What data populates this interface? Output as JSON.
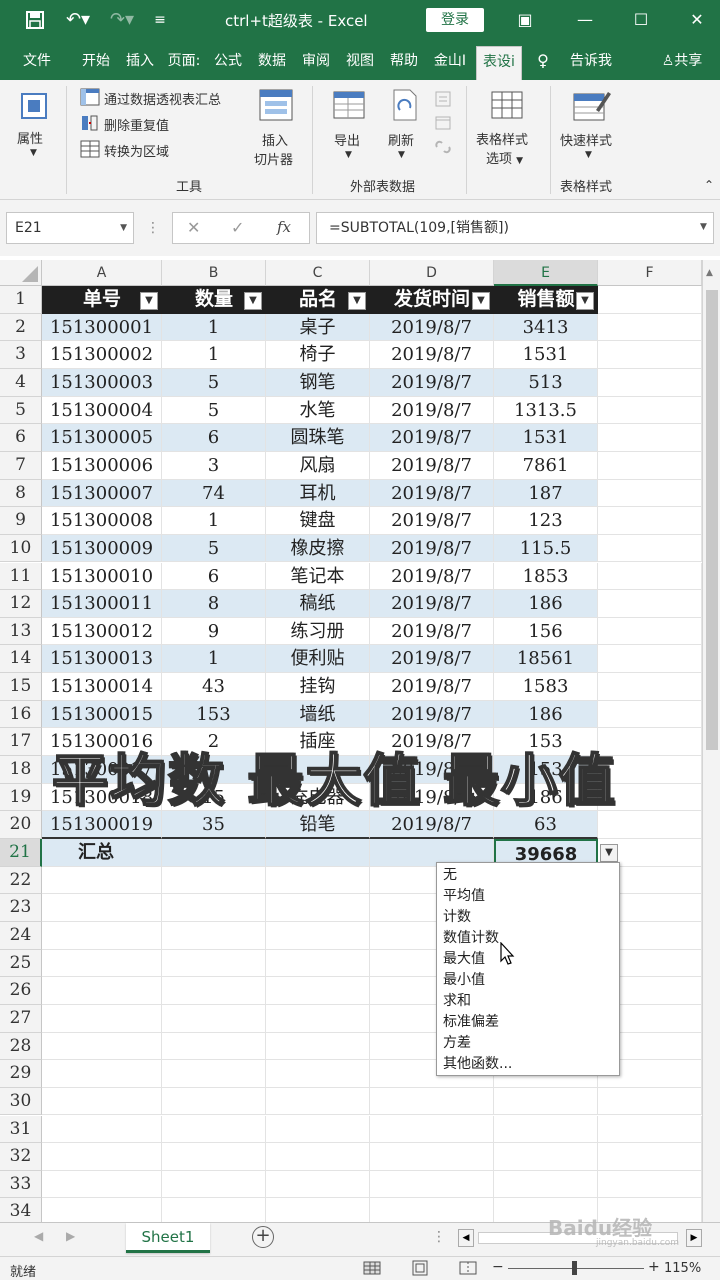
{
  "titlebar": {
    "save_icon": "save-icon",
    "undo_icon": "undo-icon",
    "redo_icon": "redo-icon",
    "title": "ctrl+t超级表  -  Excel",
    "login": "登录"
  },
  "tabs": [
    "文件",
    "开始",
    "插入",
    "页面:",
    "公式",
    "数据",
    "审阅",
    "视图",
    "帮助",
    "金山I",
    "表设i"
  ],
  "tell_me": "告诉我",
  "share": "共享",
  "ribbon": {
    "properties": "属性",
    "pivot": "通过数据透视表汇总",
    "remove_dup": "删除重复值",
    "convert": "转换为区域",
    "slicer_line1": "插入",
    "slicer_line2": "切片器",
    "group_tools": "工具",
    "export": "导出",
    "refresh": "刷新",
    "group_external": "外部表数据",
    "style_options_line1": "表格样式",
    "style_options_line2": "选项",
    "quick_styles": "快速样式",
    "group_styles": "表格样式"
  },
  "formula_bar": {
    "name_box": "E21",
    "cancel": "✕",
    "enter": "✓",
    "fx": "fx",
    "formula": "=SUBTOTAL(109,[销售额])"
  },
  "columns": [
    "A",
    "B",
    "C",
    "D",
    "E",
    "F"
  ],
  "table": {
    "headers": [
      "单号",
      "数量",
      "品名",
      "发货时间",
      "销售额"
    ],
    "rows": [
      [
        "151300001",
        "1",
        "桌子",
        "2019/8/7",
        "3413"
      ],
      [
        "151300002",
        "1",
        "椅子",
        "2019/8/7",
        "1531"
      ],
      [
        "151300003",
        "5",
        "钢笔",
        "2019/8/7",
        "513"
      ],
      [
        "151300004",
        "5",
        "水笔",
        "2019/8/7",
        "1313.5"
      ],
      [
        "151300005",
        "6",
        "圆珠笔",
        "2019/8/7",
        "1531"
      ],
      [
        "151300006",
        "3",
        "风扇",
        "2019/8/7",
        "7861"
      ],
      [
        "151300007",
        "74",
        "耳机",
        "2019/8/7",
        "187"
      ],
      [
        "151300008",
        "1",
        "键盘",
        "2019/8/7",
        "123"
      ],
      [
        "151300009",
        "5",
        "橡皮擦",
        "2019/8/7",
        "115.5"
      ],
      [
        "151300010",
        "6",
        "笔记本",
        "2019/8/7",
        "1853"
      ],
      [
        "151300011",
        "8",
        "稿纸",
        "2019/8/7",
        "186"
      ],
      [
        "151300012",
        "9",
        "练习册",
        "2019/8/7",
        "156"
      ],
      [
        "151300013",
        "1",
        "便利贴",
        "2019/8/7",
        "18561"
      ],
      [
        "151300014",
        "43",
        "挂钩",
        "2019/8/7",
        "1583"
      ],
      [
        "151300015",
        "153",
        "墙纸",
        "2019/8/7",
        "186"
      ],
      [
        "151300016",
        "2",
        "插座",
        "2019/8/7",
        "153"
      ],
      [
        "151300017",
        "",
        "",
        "2019/8/7",
        "153"
      ],
      [
        "151300018",
        "15",
        "充电器",
        "2019/8/7",
        "186"
      ],
      [
        "151300019",
        "35",
        "铅笔",
        "2019/8/7",
        "63"
      ]
    ],
    "total_label": "汇总",
    "total_value": "39668"
  },
  "dropdown": [
    "无",
    "平均值",
    "计数",
    "数值计数",
    "最大值",
    "最小值",
    "求和",
    "标准偏差",
    "方差",
    "其他函数..."
  ],
  "overlay_text": "平均数  最大值  最小值",
  "sheet_tab": "Sheet1",
  "status": {
    "ready": "就绪",
    "zoom": "115%"
  },
  "watermark": "Baidu经验",
  "watermark_sub": "jingyan.baidu.com",
  "colors": {
    "excel_green": "#217346",
    "header_fill": "#1f1f1f",
    "band_fill": "#dce9f3"
  }
}
